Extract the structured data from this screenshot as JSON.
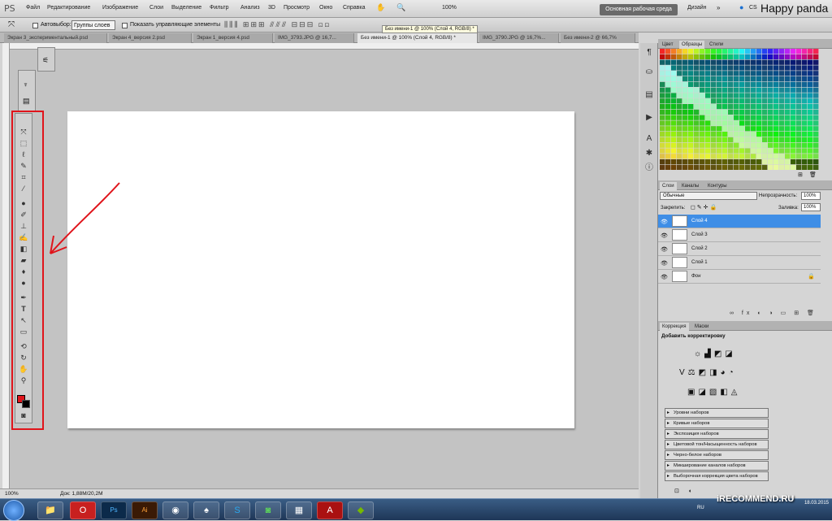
{
  "app": {
    "logo": "PS"
  },
  "menu": [
    "Файл",
    "Редактирование",
    "Изображение",
    "Слои",
    "Выделение",
    "Фильтр",
    "Анализ",
    "3D",
    "Просмотр",
    "Окно",
    "Справка"
  ],
  "menu_extra": {
    "zoom": "100%"
  },
  "workspace": {
    "active": "Основная рабочая среда",
    "design": "Дизайн",
    "cs": "CS"
  },
  "overlay_title": "Happy panda",
  "options": {
    "autoselect_label": "Автовыбор:",
    "autoselect_value": "Группы слоев",
    "show_controls": "Показать управляющие элементы"
  },
  "tabs": [
    {
      "label": "Экран 3_экспериментальный.psd",
      "active": false
    },
    {
      "label": "Экран 4_версия 2.psd",
      "active": false
    },
    {
      "label": "Экран 1_версия 4.psd",
      "active": false
    },
    {
      "label": "IMG_3793.JPG @ 16,7...",
      "active": false
    },
    {
      "label": "Без имени-1 @ 100% (Слой 4, RGB/8) *",
      "active": true
    },
    {
      "label": "IMG_3790.JPG @ 16,7%...",
      "active": false
    },
    {
      "label": "Без имени-2 @ 66,7%",
      "active": false
    }
  ],
  "tooltip": "Без имени-1 @ 100% (Слой 4, RGB/8) *",
  "status": {
    "zoom": "100%",
    "doc": "Док: 1,88M/20,2M"
  },
  "swatches": {
    "tabs": [
      "Цвет",
      "Образцы",
      "Стили"
    ]
  },
  "layers": {
    "tabs": [
      "Слои",
      "Каналы",
      "Контуры"
    ],
    "blend_mode": "Обычные",
    "opacity_label": "Непрозрачность:",
    "opacity_value": "100%",
    "lock_label": "Закрепить:",
    "fill_label": "Заливка:",
    "fill_value": "100%",
    "items": [
      {
        "name": "Слой 4",
        "selected": true
      },
      {
        "name": "Слой 3",
        "selected": false
      },
      {
        "name": "Слой 2",
        "selected": false
      },
      {
        "name": "Слой 1",
        "selected": false
      },
      {
        "name": "Фон",
        "selected": false
      }
    ]
  },
  "correction": {
    "tabs": [
      "Коррекция",
      "Маски"
    ],
    "heading": "Добавить корректировку",
    "presets": [
      "Уровни наборов",
      "Кривые наборов",
      "Экспозиция наборов",
      "Цветовой тон/Насыщенность наборов",
      "Черно-белое наборов",
      "Микширование каналов наборов",
      "Выборочная коррекция цвета наборов"
    ]
  },
  "taskbar": {
    "lang": "RU",
    "date": "18.03.2015"
  },
  "watermark": "iRECOMMEND.RU",
  "colors": {
    "accent_red": "#e0141b",
    "layer_selected": "#3f8ee6"
  }
}
